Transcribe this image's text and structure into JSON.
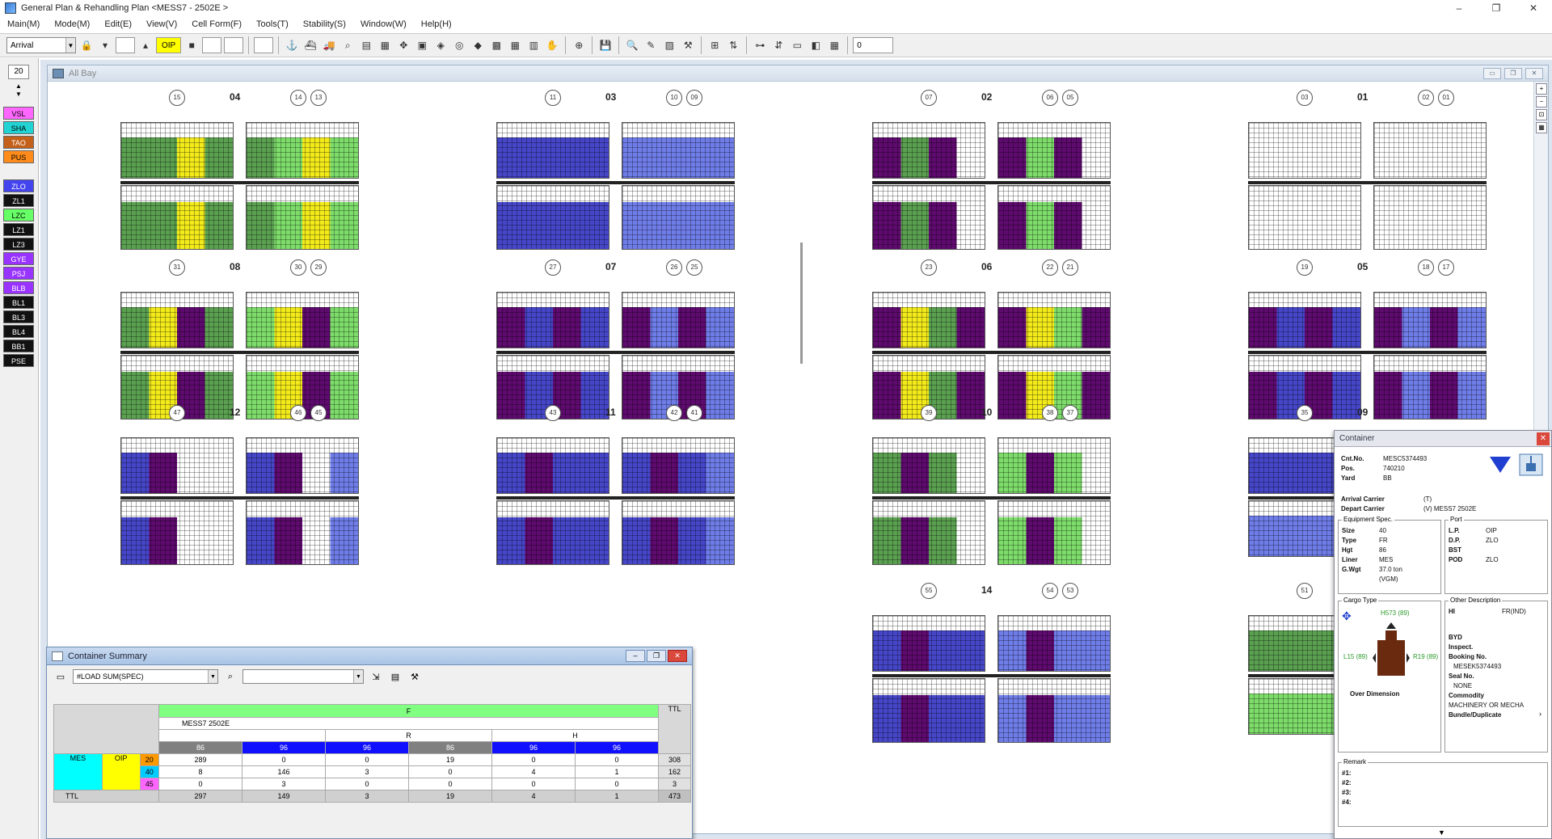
{
  "window": {
    "title": "General Plan & Rehandling Plan <MESS7 - 2502E >",
    "controls": [
      "–",
      "❐",
      "✕"
    ]
  },
  "menu": [
    "Main(M)",
    "Mode(M)",
    "Edit(E)",
    "View(V)",
    "Cell Form(F)",
    "Tools(T)",
    "Stability(S)",
    "Window(W)",
    "Help(H)"
  ],
  "toolbar": {
    "mode_select": "Arrival",
    "port_badge": "OIP",
    "counter": "0"
  },
  "left_panel": {
    "number": "20",
    "tags": [
      {
        "label": "VSL",
        "color": "#ff66ff",
        "text_color": "#000"
      },
      {
        "label": "SHA",
        "color": "#22d3d3",
        "text_color": "#000"
      },
      {
        "label": "TAO",
        "color": "#c4601a",
        "text_color": "#fff"
      },
      {
        "label": "PUS",
        "color": "#ff8c1a",
        "text_color": "#000"
      },
      {
        "label": "ZLO",
        "color": "#4444ee",
        "text_color": "#fff"
      },
      {
        "label": "ZL1",
        "color": "#111111",
        "text_color": "#fff"
      },
      {
        "label": "LZC",
        "color": "#66ff66",
        "text_color": "#000"
      },
      {
        "label": "LZ1",
        "color": "#111111",
        "text_color": "#fff"
      },
      {
        "label": "LZ3",
        "color": "#111111",
        "text_color": "#fff"
      },
      {
        "label": "GYE",
        "color": "#9933ff",
        "text_color": "#fff"
      },
      {
        "label": "PSJ",
        "color": "#9933ff",
        "text_color": "#fff"
      },
      {
        "label": "BLB",
        "color": "#9933ff",
        "text_color": "#fff"
      },
      {
        "label": "BL1",
        "color": "#111111",
        "text_color": "#fff"
      },
      {
        "label": "BL3",
        "color": "#111111",
        "text_color": "#fff"
      },
      {
        "label": "BL4",
        "color": "#111111",
        "text_color": "#fff"
      },
      {
        "label": "BB1",
        "color": "#111111",
        "text_color": "#fff"
      },
      {
        "label": "PSE",
        "color": "#111111",
        "text_color": "#fff"
      }
    ]
  },
  "all_bay": {
    "title": "All Bay",
    "bays": [
      {
        "label": "04",
        "circles": [
          "15",
          "14",
          "13"
        ]
      },
      {
        "label": "03",
        "circles": [
          "11",
          "10",
          "09"
        ]
      },
      {
        "label": "02",
        "circles": [
          "07",
          "06",
          "05"
        ]
      },
      {
        "label": "01",
        "circles": [
          "03",
          "02",
          "01"
        ]
      },
      {
        "label": "08",
        "circles": [
          "31",
          "30",
          "29"
        ]
      },
      {
        "label": "07",
        "circles": [
          "27",
          "26",
          "25"
        ]
      },
      {
        "label": "06",
        "circles": [
          "23",
          "22",
          "21"
        ]
      },
      {
        "label": "05",
        "circles": [
          "19",
          "18",
          "17"
        ]
      },
      {
        "label": "12",
        "circles": [
          "47",
          "46",
          "45"
        ]
      },
      {
        "label": "11",
        "circles": [
          "43",
          "42",
          "41"
        ]
      },
      {
        "label": "10",
        "circles": [
          "39",
          "38",
          "37"
        ]
      },
      {
        "label": "09",
        "circles": [
          "35"
        ]
      },
      {
        "label": "14",
        "circles": [
          "55",
          "54",
          "53"
        ]
      },
      {
        "label": "13",
        "circles": [
          "51"
        ]
      }
    ],
    "colors": {
      "green": "#5aa050",
      "lightgreen": "#7ddc6a",
      "yellow": "#f2ea1a",
      "purple": "#5e0a6e",
      "blue": "#4646c8",
      "lightblue": "#6f7de8"
    }
  },
  "summary": {
    "title": "Container Summary",
    "select1": "#LOAD SUM(SPEC)",
    "select2": "",
    "header_group": "F",
    "voyage": "MESS7 2502E",
    "subgroups": [
      "R",
      "H",
      "RH"
    ],
    "spec_row": [
      "86",
      "96",
      "96",
      "86",
      "96",
      "96"
    ],
    "ttl_label": "TTL",
    "left_labels": {
      "carrier": "MES",
      "port": "OIP"
    },
    "rows": [
      {
        "size": "20",
        "values": [
          "289",
          "0",
          "0",
          "19",
          "0",
          "0"
        ],
        "ttl": "308"
      },
      {
        "size": "40",
        "values": [
          "8",
          "146",
          "3",
          "0",
          "4",
          "1"
        ],
        "ttl": "162"
      },
      {
        "size": "45",
        "values": [
          "0",
          "3",
          "0",
          "0",
          "0",
          "0"
        ],
        "ttl": "3"
      }
    ],
    "total_row": {
      "label": "TTL",
      "values": [
        "297",
        "149",
        "3",
        "19",
        "4",
        "1"
      ],
      "ttl": "473"
    }
  },
  "container": {
    "title": "Container",
    "cntr_no": "MESC5374493",
    "pos": "740210",
    "yard": "BB",
    "arrival_carrier_label": "Arrival Carrier",
    "arrival_carrier": "(T)",
    "depart_carrier_label": "Depart Carrier",
    "depart_carrier": "(V)  MESS7 2502E",
    "equipment_title": "Equipment Spec.",
    "size": "40",
    "type": "FR",
    "hgt": "86",
    "liner": "MES",
    "gwgt": "37.0 ton",
    "gwgt_note": "(VGM)",
    "port_title": "Port",
    "lp": "OIP",
    "dp": "ZLO",
    "bst": "",
    "pod": "ZLO",
    "cargo_title": "Cargo Type",
    "cargo_top": "H573 (89)",
    "cargo_left": "L15 (89)",
    "cargo_right": "R19 (89)",
    "over_dimension": "Over Dimension",
    "other_title": "Other Description",
    "hi": "HI",
    "fr_ind": "FR(IND)",
    "byd": "BYD",
    "inspect": "Inspect.",
    "booking_label": "Booking No.",
    "booking": "MESEK5374493",
    "seal_label": "Seal No.",
    "seal": "NONE",
    "commodity_label": "Commodity",
    "commodity": "MACHINERY OR MECHA",
    "bundle": "Bundle/Duplicate",
    "remark_title": "Remark",
    "remarks": [
      "#1:",
      "#2:",
      "#3:",
      "#4:"
    ]
  }
}
